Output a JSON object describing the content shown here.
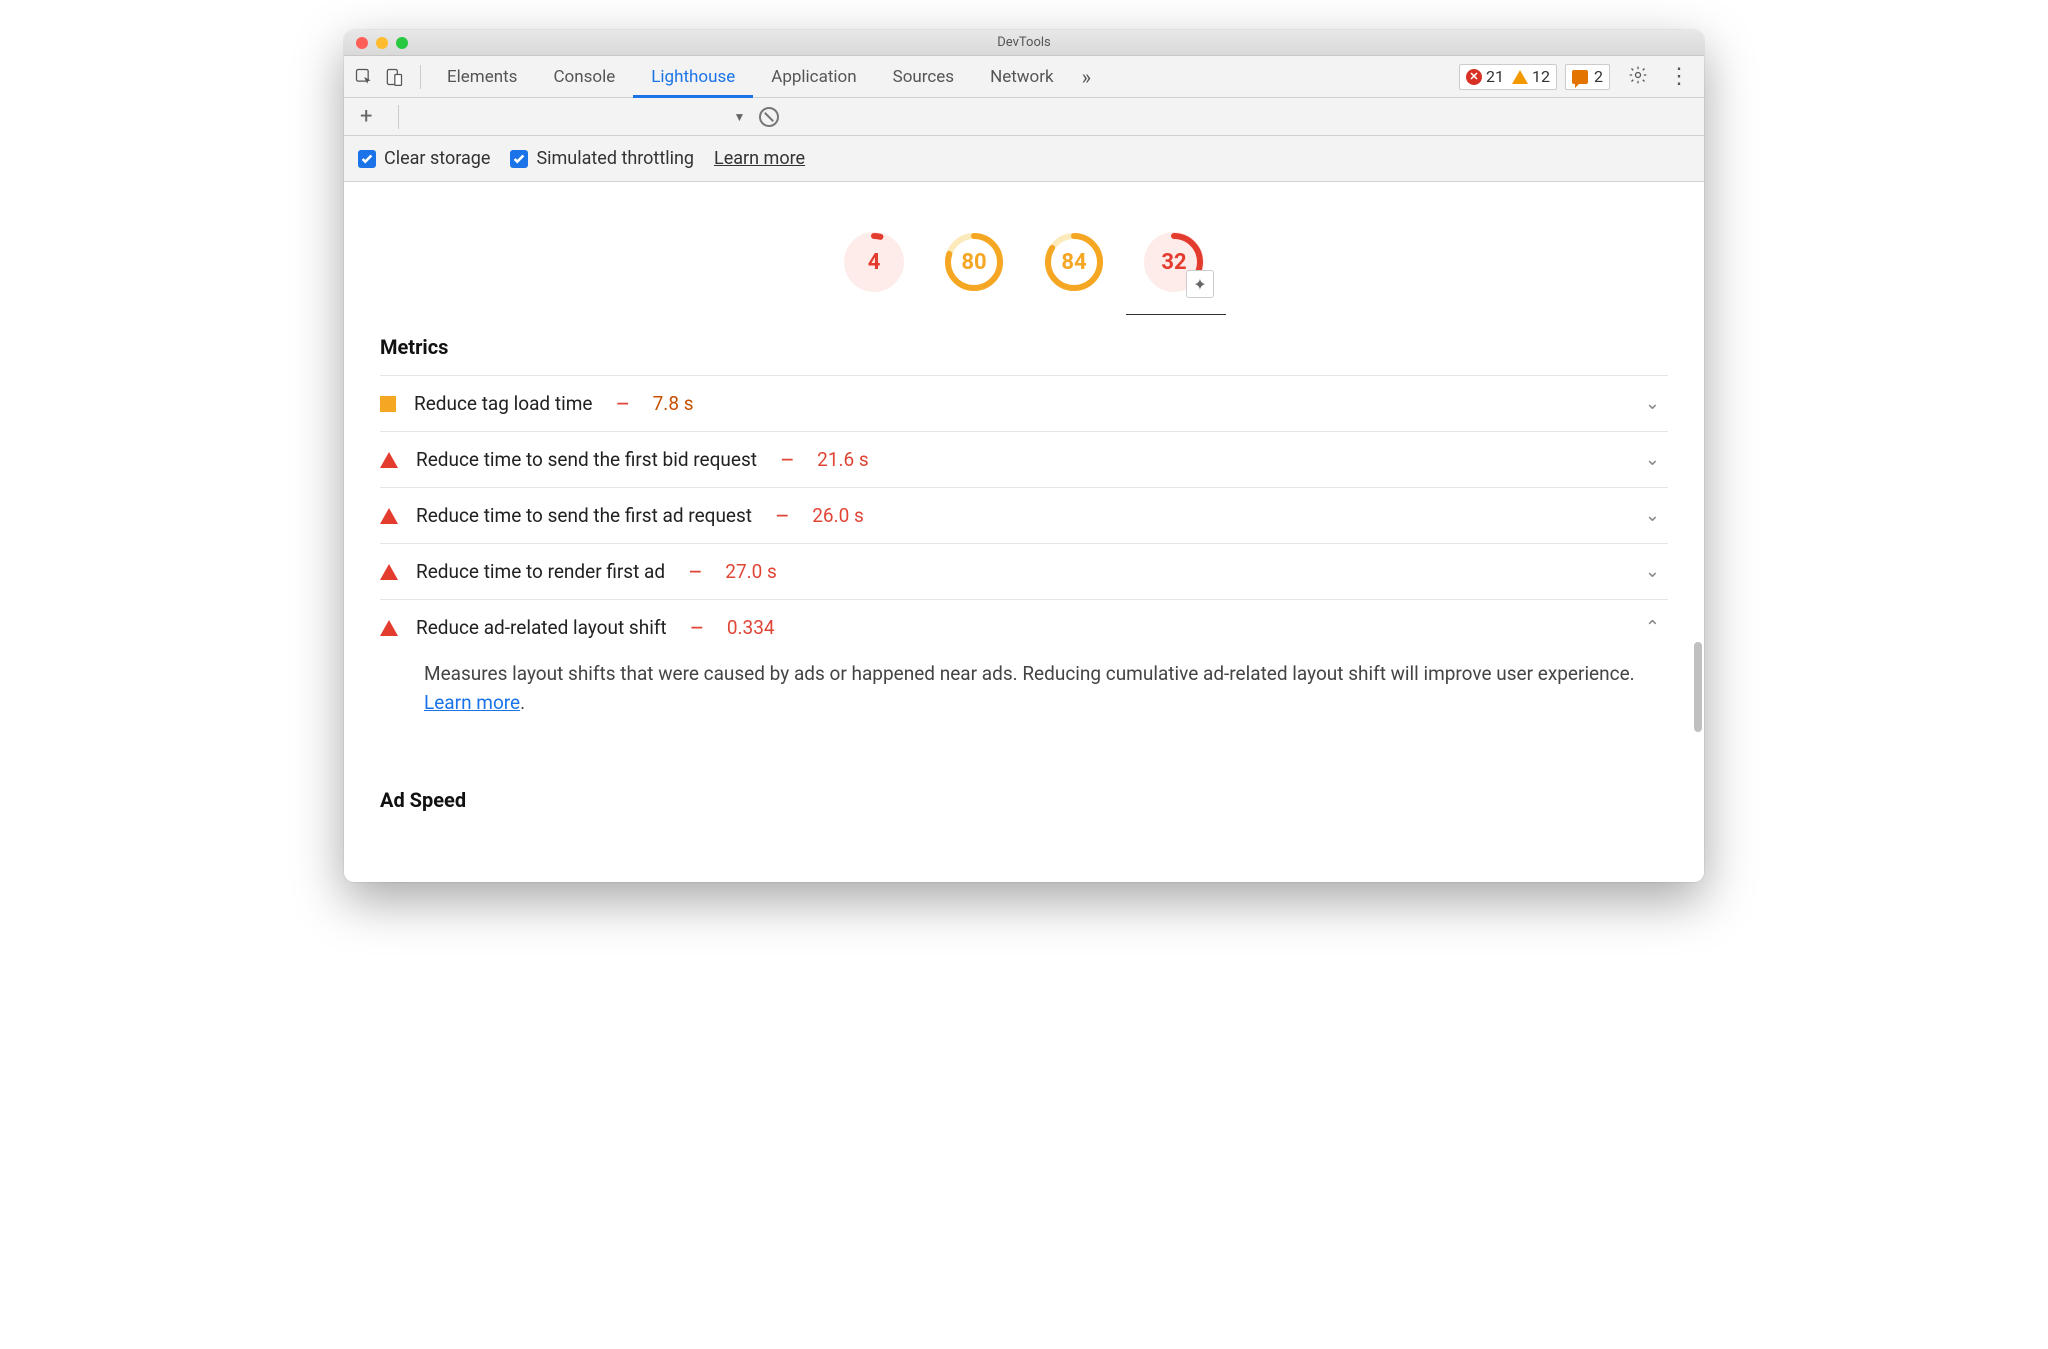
{
  "window_title": "DevTools",
  "tabs": {
    "elements": "Elements",
    "console": "Console",
    "lighthouse": "Lighthouse",
    "application": "Application",
    "sources": "Sources",
    "network": "Network"
  },
  "counts": {
    "errors": "21",
    "warnings": "12",
    "messages": "2"
  },
  "options": {
    "clear_storage": "Clear storage",
    "simulated_throttling": "Simulated throttling",
    "learn_more": "Learn more"
  },
  "gauges": [
    {
      "value": "4",
      "color": "red",
      "pct": 4
    },
    {
      "value": "80",
      "color": "orange",
      "pct": 80
    },
    {
      "value": "84",
      "color": "orange",
      "pct": 84
    },
    {
      "value": "32",
      "color": "red",
      "pct": 32,
      "plugin": true
    }
  ],
  "metrics_heading": "Metrics",
  "metrics": [
    {
      "icon": "sq",
      "title": "Reduce tag load time",
      "value": "7.8 s",
      "vclass": "orange",
      "open": false
    },
    {
      "icon": "tri",
      "title": "Reduce time to send the first bid request",
      "value": "21.6 s",
      "vclass": "",
      "open": false
    },
    {
      "icon": "tri",
      "title": "Reduce time to send the first ad request",
      "value": "26.0 s",
      "vclass": "",
      "open": false
    },
    {
      "icon": "tri",
      "title": "Reduce time to render first ad",
      "value": "27.0 s",
      "vclass": "",
      "open": false
    },
    {
      "icon": "tri",
      "title": "Reduce ad-related layout shift",
      "value": "0.334",
      "vclass": "",
      "open": true,
      "desc": "Measures layout shifts that were caused by ads or happened near ads. Reducing cumulative ad-related layout shift will improve user experience. ",
      "desc_link": "Learn more"
    }
  ],
  "ad_speed_heading": "Ad Speed"
}
